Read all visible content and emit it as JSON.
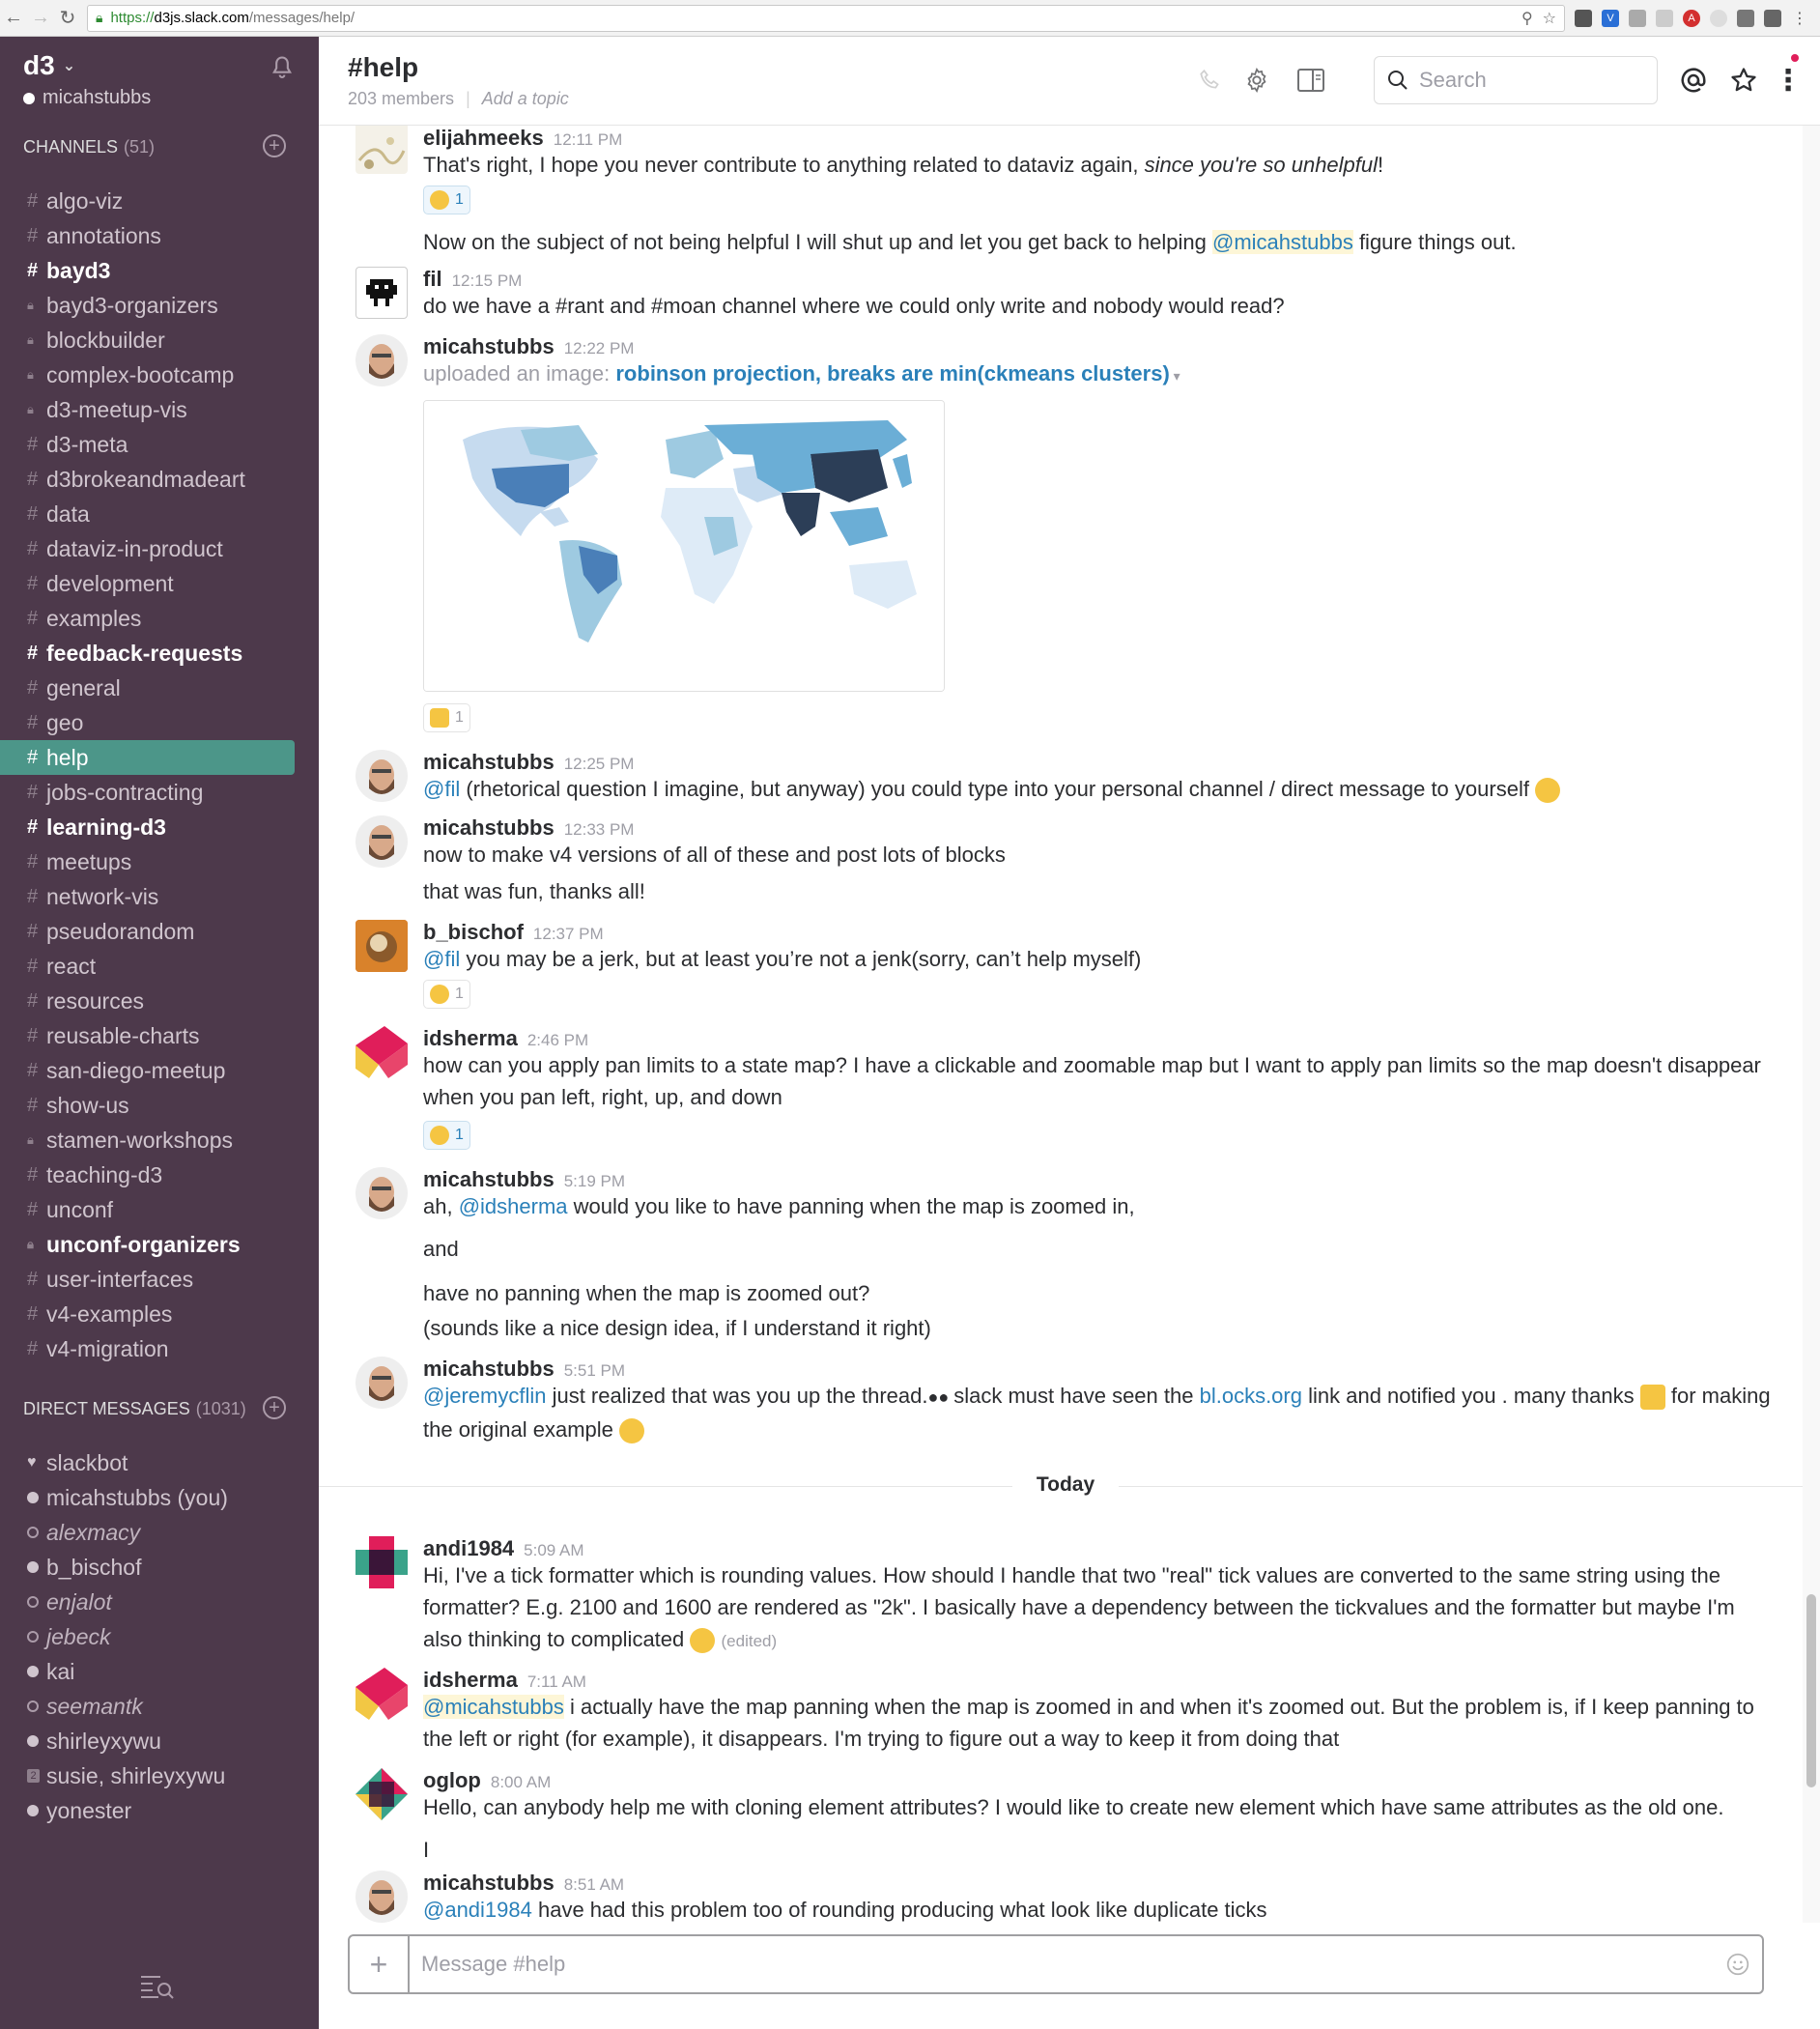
{
  "browser": {
    "url_https": "https://",
    "url_host": "d3js.slack.com",
    "url_path": "/messages/help/"
  },
  "team": {
    "name": "d3",
    "user": "micahstubbs"
  },
  "channels": {
    "header": "CHANNELS",
    "count": "(51)",
    "items": [
      {
        "name": "algo-viz",
        "type": "public",
        "bold": false
      },
      {
        "name": "annotations",
        "type": "public",
        "bold": false
      },
      {
        "name": "bayd3",
        "type": "public",
        "bold": true
      },
      {
        "name": "bayd3-organizers",
        "type": "private",
        "bold": false
      },
      {
        "name": "blockbuilder",
        "type": "private",
        "bold": false
      },
      {
        "name": "complex-bootcamp",
        "type": "private",
        "bold": false
      },
      {
        "name": "d3-meetup-vis",
        "type": "private",
        "bold": false
      },
      {
        "name": "d3-meta",
        "type": "public",
        "bold": false
      },
      {
        "name": "d3brokeandmadeart",
        "type": "public",
        "bold": false
      },
      {
        "name": "data",
        "type": "public",
        "bold": false
      },
      {
        "name": "dataviz-in-product",
        "type": "public",
        "bold": false
      },
      {
        "name": "development",
        "type": "public",
        "bold": false
      },
      {
        "name": "examples",
        "type": "public",
        "bold": false
      },
      {
        "name": "feedback-requests",
        "type": "public",
        "bold": true
      },
      {
        "name": "general",
        "type": "public",
        "bold": false
      },
      {
        "name": "geo",
        "type": "public",
        "bold": false
      },
      {
        "name": "help",
        "type": "public",
        "bold": false,
        "active": true
      },
      {
        "name": "jobs-contracting",
        "type": "public",
        "bold": false
      },
      {
        "name": "learning-d3",
        "type": "public",
        "bold": true
      },
      {
        "name": "meetups",
        "type": "public",
        "bold": false
      },
      {
        "name": "network-vis",
        "type": "public",
        "bold": false
      },
      {
        "name": "pseudorandom",
        "type": "public",
        "bold": false
      },
      {
        "name": "react",
        "type": "public",
        "bold": false
      },
      {
        "name": "resources",
        "type": "public",
        "bold": false
      },
      {
        "name": "reusable-charts",
        "type": "public",
        "bold": false
      },
      {
        "name": "san-diego-meetup",
        "type": "public",
        "bold": false
      },
      {
        "name": "show-us",
        "type": "public",
        "bold": false
      },
      {
        "name": "stamen-workshops",
        "type": "private",
        "bold": false
      },
      {
        "name": "teaching-d3",
        "type": "public",
        "bold": false
      },
      {
        "name": "unconf",
        "type": "public",
        "bold": false
      },
      {
        "name": "unconf-organizers",
        "type": "private",
        "bold": true
      },
      {
        "name": "user-interfaces",
        "type": "public",
        "bold": false
      },
      {
        "name": "v4-examples",
        "type": "public",
        "bold": false
      },
      {
        "name": "v4-migration",
        "type": "public",
        "bold": false
      }
    ]
  },
  "dms": {
    "header": "DIRECT MESSAGES",
    "count": "(1031)",
    "items": [
      {
        "name": "slackbot",
        "status": "heart"
      },
      {
        "name": "micahstubbs (you)",
        "status": "online"
      },
      {
        "name": "alexmacy",
        "status": "away"
      },
      {
        "name": "b_bischof",
        "status": "online"
      },
      {
        "name": "enjalot",
        "status": "away"
      },
      {
        "name": "jebeck",
        "status": "away"
      },
      {
        "name": "kai",
        "status": "online"
      },
      {
        "name": "seemantk",
        "status": "away"
      },
      {
        "name": "shirleyxywu",
        "status": "online"
      },
      {
        "name": "susie, shirleyxywu",
        "status": "group",
        "group_count": "2"
      },
      {
        "name": "yonester",
        "status": "online"
      }
    ]
  },
  "header": {
    "channel": "#help",
    "members": "203 members",
    "topic_placeholder": "Add a topic",
    "search_placeholder": "Search"
  },
  "messages": {
    "m1_author": "elijahmeeks",
    "m1_time": "12:11 PM",
    "m1_text_a": "That's right, I hope you never contribute to anything related to dataviz again, ",
    "m1_text_em": "since you're so unhelpful",
    "m1_text_b": "!",
    "m1_reaction": "1",
    "m1_text2_a": "Now on the subject of not being helpful I will shut up and let you get back to helping ",
    "m1_text2_mention": "@micahstubbs",
    "m1_text2_b": " figure things out.",
    "m2_author": "fil",
    "m2_time": "12:15 PM",
    "m2_text": "do we have a #rant and #moan channel where we could only write and nobody would read?",
    "m3_author": "micahstubbs",
    "m3_time": "12:22 PM",
    "m3_upload": "uploaded an image: ",
    "m3_file": "robinson projection, breaks are min(ckmeans clusters)",
    "m3_reaction": "1",
    "m4_author": "micahstubbs",
    "m4_time": "12:25 PM",
    "m4_mention": "@fil",
    "m4_text": " (rhetorical question I imagine, but anyway) you could type into your personal channel / direct message to yourself",
    "m5_author": "micahstubbs",
    "m5_time": "12:33 PM",
    "m5_text": "now to make v4 versions of all of these and post lots of blocks",
    "m5_text2": "that was fun,  thanks all!",
    "m6_author": "b_bischof",
    "m6_time": "12:37 PM",
    "m6_mention": "@fil",
    "m6_text": " you may be a jerk, but at least you’re not a jenk(sorry, can’t help myself)",
    "m6_reaction": "1",
    "m7_author": "idsherma",
    "m7_time": "2:46 PM",
    "m7_text": "how can you apply pan limits to a state map? I have a clickable and zoomable map but I want to apply pan limits so the map doesn't disappear when you pan left, right, up, and down",
    "m7_reaction": "1",
    "m8_author": "micahstubbs",
    "m8_time": "5:19 PM",
    "m8_text_a": "ah,  ",
    "m8_mention": "@idsherma",
    "m8_text_b": " would you like to have panning when the map is zoomed in,",
    "m8_text2": "and",
    "m8_text3": "have no panning when the map is zoomed out?",
    "m8_text4": "(sounds like a nice design idea,  if I understand it right)",
    "m9_author": "micahstubbs",
    "m9_time": "5:51 PM",
    "m9_mention": "@jeremycflin",
    "m9_text_a": " just realized that was you up the thread.",
    "m9_text_b": " slack must have seen the ",
    "m9_link": "bl.ocks.org",
    "m9_text_c": " link and notified you .  many thanks ",
    "m9_text_d": " for making the original example ",
    "today": "Today",
    "m10_author": "andi1984",
    "m10_time": "5:09 AM",
    "m10_text": "Hi, I've a tick formatter which is rounding values. How should I handle that two \"real\" tick values are converted to the same string using the formatter? E.g. 2100 and 1600 are rendered as \"2k\". I basically have a dependency between the tickvalues and the formatter but maybe I'm also thinking to complicated ",
    "m10_edited": "(edited)",
    "m11_author": "idsherma",
    "m11_time": "7:11 AM",
    "m11_mention": "@micahstubbs",
    "m11_text": " i actually have the map panning when the map is zoomed in and when it's zoomed out. But the problem is, if I keep panning to the left or right (for example), it disappears. I'm trying to figure out a way to keep it from doing that",
    "m12_author": "oglop",
    "m12_time": "8:00 AM",
    "m12_text": "Hello, can anybody help me with cloning element attributes? I would like to create new element which have same attributes as the old one.",
    "m12_text2": "I",
    "m13_author": "micahstubbs",
    "m13_time": "8:51 AM",
    "m13_mention": "@andi1984",
    "m13_text": " have had this problem too of rounding producing what look like duplicate ticks"
  },
  "composer": {
    "placeholder": "Message #help"
  },
  "colors": {
    "sidebar_bg": "#4d394b",
    "active_channel": "#4c9689",
    "link": "#2a80b9"
  }
}
